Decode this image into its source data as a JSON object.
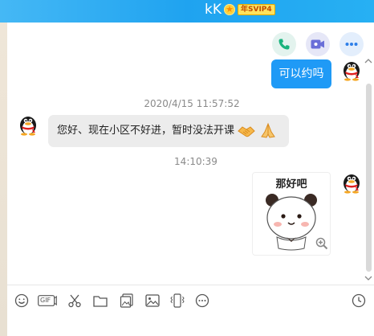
{
  "window": {
    "contact_name": "kK",
    "vip_badge": "年SVIP4"
  },
  "actions": {
    "call_icon": "phone-icon",
    "video_icon": "video-camera-icon",
    "more_icon": "more-dots-icon"
  },
  "messages": [
    {
      "sender": "me",
      "type": "text",
      "text": "可以约吗"
    },
    {
      "type": "timestamp",
      "text": "2020/4/15 11:57:52"
    },
    {
      "sender": "contact",
      "type": "text",
      "text": "您好、现在小区不好进，暂时没法开课",
      "emojis": [
        "handshake-emoji",
        "hands-together-emoji"
      ]
    },
    {
      "type": "timestamp",
      "text": "14:10:39"
    },
    {
      "sender": "me",
      "type": "sticker",
      "text": "那好吧",
      "sticker_icon": "panda-bear-sticker",
      "zoom_icon": "zoom-in-icon"
    }
  ],
  "toolbar": {
    "icons": [
      "smiley-icon",
      "gif-icon",
      "scissors-icon",
      "folder-icon",
      "image-file-icon",
      "picture-icon",
      "vibrate-icon",
      "more-icon",
      "history-clock-icon"
    ],
    "gif_label": "GIF"
  },
  "colors": {
    "title_bar": "#1fa3f0",
    "my_bubble": "#1f9af6",
    "their_bubble": "#ececec"
  }
}
